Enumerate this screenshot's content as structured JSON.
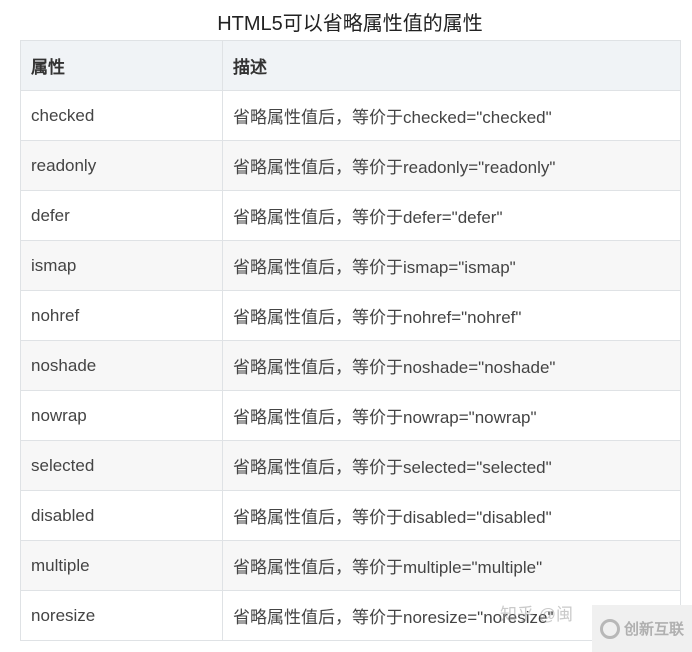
{
  "title": "HTML5可以省略属性值的属性",
  "table": {
    "headers": [
      "属性",
      "描述"
    ],
    "rows": [
      [
        "checked",
        "省略属性值后，等价于checked=\"checked\""
      ],
      [
        "readonly",
        "省略属性值后，等价于readonly=\"readonly\""
      ],
      [
        "defer",
        "省略属性值后，等价于defer=\"defer\""
      ],
      [
        "ismap",
        "省略属性值后，等价于ismap=\"ismap\""
      ],
      [
        "nohref",
        "省略属性值后，等价于nohref=\"nohref\""
      ],
      [
        "noshade",
        "省略属性值后，等价于noshade=\"noshade\""
      ],
      [
        "nowrap",
        "省略属性值后，等价于nowrap=\"nowrap\""
      ],
      [
        "selected",
        "省略属性值后，等价于selected=\"selected\""
      ],
      [
        "disabled",
        "省略属性值后，等价于disabled=\"disabled\""
      ],
      [
        "multiple",
        "省略属性值后，等价于multiple=\"multiple\""
      ],
      [
        "noresize",
        "省略属性值后，等价于noresize=\"noresize\""
      ]
    ]
  },
  "watermark": "知乎 @闽",
  "logo": {
    "icon": "chuangxin-logo-icon",
    "text": "创新互联"
  }
}
